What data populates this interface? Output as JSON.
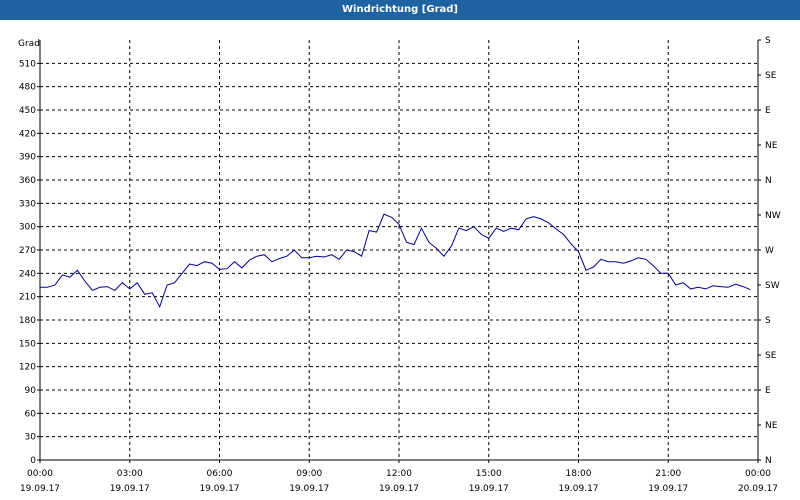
{
  "window": {
    "title": "Windrichtung [Grad]"
  },
  "chart_data": {
    "type": "line",
    "title": "Windrichtung [Grad]",
    "ylabel": "Grad",
    "ylim": [
      0,
      540
    ],
    "yticks": [
      0,
      30,
      60,
      90,
      120,
      150,
      180,
      210,
      240,
      270,
      300,
      330,
      360,
      390,
      420,
      450,
      480,
      510
    ],
    "right_axis": {
      "ticks": [
        0,
        45,
        90,
        135,
        180,
        225,
        270,
        315,
        360,
        405,
        450,
        495,
        540
      ],
      "labels": [
        "N",
        "NE",
        "E",
        "SE",
        "S",
        "SW",
        "W",
        "NW",
        "N",
        "NE",
        "E",
        "SE",
        "S"
      ]
    },
    "xlim": [
      0,
      24
    ],
    "xticks": [
      {
        "h": 0,
        "time": "00:00",
        "date": "19.09.17"
      },
      {
        "h": 3,
        "time": "03:00",
        "date": "19.09.17"
      },
      {
        "h": 6,
        "time": "06:00",
        "date": "19.09.17"
      },
      {
        "h": 9,
        "time": "09:00",
        "date": "19.09.17"
      },
      {
        "h": 12,
        "time": "12:00",
        "date": "19.09.17"
      },
      {
        "h": 15,
        "time": "15:00",
        "date": "19.09.17"
      },
      {
        "h": 18,
        "time": "18:00",
        "date": "19.09.17"
      },
      {
        "h": 21,
        "time": "21:00",
        "date": "19.09.17"
      },
      {
        "h": 24,
        "time": "00:00",
        "date": "20.09.17"
      }
    ],
    "grid": true,
    "line_color": "#00008b",
    "series": [
      {
        "x": [
          0.0,
          0.25,
          0.5,
          0.75,
          1.0,
          1.25,
          1.5,
          1.75,
          2.0,
          2.25,
          2.5,
          2.75,
          3.0,
          3.25,
          3.5,
          3.75,
          4.0,
          4.25,
          4.5,
          4.75,
          5.0,
          5.25,
          5.5,
          5.75,
          6.0,
          6.25,
          6.5,
          6.75,
          7.0,
          7.25,
          7.5,
          7.75,
          8.0,
          8.25,
          8.5,
          8.75,
          9.0,
          9.25,
          9.5,
          9.75,
          10.0,
          10.25,
          10.5,
          10.75,
          11.0,
          11.25,
          11.5,
          11.75,
          12.0,
          12.25,
          12.5,
          12.75,
          13.0,
          13.25,
          13.5,
          13.75,
          14.0,
          14.25,
          14.5,
          14.75,
          15.0,
          15.25,
          15.5,
          15.75,
          16.0,
          16.25,
          16.5,
          16.75,
          17.0,
          17.25,
          17.5,
          17.75,
          18.0,
          18.25,
          18.5,
          18.75,
          19.0,
          19.25,
          19.5,
          19.75,
          20.0,
          20.25,
          20.5,
          20.75,
          21.0,
          21.25,
          21.5,
          21.75,
          22.0,
          22.25,
          22.5,
          22.75,
          23.0,
          23.25,
          23.5,
          23.75
        ],
        "y": [
          222,
          222,
          225,
          238,
          235,
          244,
          230,
          218,
          222,
          223,
          218,
          228,
          220,
          228,
          213,
          215,
          197,
          225,
          228,
          240,
          252,
          250,
          255,
          253,
          245,
          246,
          255,
          247,
          257,
          262,
          264,
          255,
          259,
          262,
          270,
          260,
          260,
          262,
          261,
          264,
          258,
          270,
          268,
          262,
          295,
          293,
          316,
          312,
          303,
          280,
          277,
          298,
          280,
          272,
          262,
          275,
          298,
          295,
          300,
          290,
          285,
          298,
          294,
          298,
          296,
          310,
          313,
          310,
          305,
          297,
          290,
          278,
          268,
          244,
          248,
          258,
          255,
          255,
          253,
          256,
          260,
          258,
          250,
          240,
          240,
          225,
          228,
          220,
          222,
          220,
          224,
          223,
          222,
          226,
          223,
          219
        ]
      }
    ]
  }
}
